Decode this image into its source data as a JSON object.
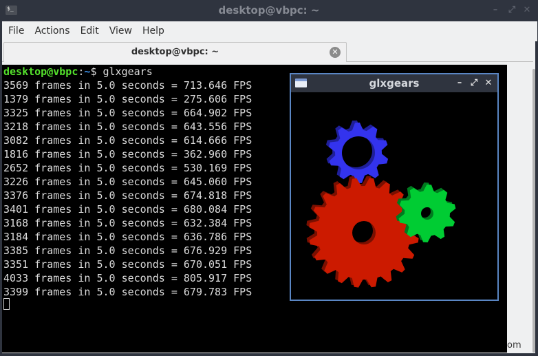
{
  "window": {
    "title": "desktop@vbpc: ~",
    "app_icon": "$_",
    "controls": {
      "minimize": "–",
      "maximize": "⤢",
      "close": "✕"
    }
  },
  "menu": [
    "File",
    "Actions",
    "Edit",
    "View",
    "Help"
  ],
  "tab": {
    "label": "desktop@vbpc: ~",
    "close_icon": "✕"
  },
  "terminal": {
    "prompt_user": "desktop@vbpc",
    "prompt_sep": ":",
    "prompt_path": "~",
    "prompt_symbol": "$ ",
    "command": "glxgears",
    "output": [
      "3569 frames in 5.0 seconds = 713.646 FPS",
      "1379 frames in 5.0 seconds = 275.606 FPS",
      "3325 frames in 5.0 seconds = 664.902 FPS",
      "3218 frames in 5.0 seconds = 643.556 FPS",
      "3082 frames in 5.0 seconds = 614.666 FPS",
      "1816 frames in 5.0 seconds = 362.960 FPS",
      "2652 frames in 5.0 seconds = 530.169 FPS",
      "3226 frames in 5.0 seconds = 645.060 FPS",
      "3376 frames in 5.0 seconds = 674.818 FPS",
      "3401 frames in 5.0 seconds = 680.084 FPS",
      "3168 frames in 5.0 seconds = 632.384 FPS",
      "3184 frames in 5.0 seconds = 636.786 FPS",
      "3385 frames in 5.0 seconds = 676.929 FPS",
      "3351 frames in 5.0 seconds = 670.051 FPS",
      "4033 frames in 5.0 seconds = 805.917 FPS",
      "3399 frames in 5.0 seconds = 679.783 FPS"
    ]
  },
  "glxgears": {
    "title": "glxgears",
    "controls": {
      "minimize": "–",
      "maximize": "⤢",
      "close": "✕"
    },
    "gear_colors": {
      "red": "#cc1a00",
      "green": "#00cc33",
      "blue": "#3333ee"
    }
  },
  "footer_text": "om"
}
